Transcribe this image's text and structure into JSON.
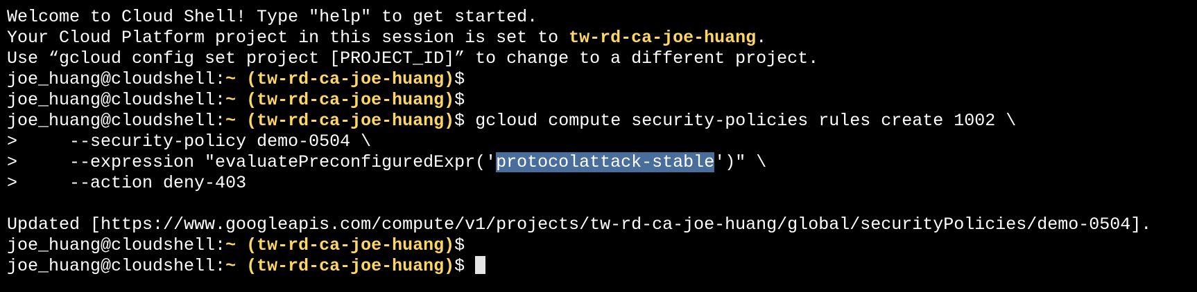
{
  "colors": {
    "background": "#000000",
    "text": "#ffffff",
    "project": "#fdd663",
    "selection": "#4a6e9c",
    "cursor": "#e5e5e5"
  },
  "welcome": {
    "line1": "Welcome to Cloud Shell! Type \"help\" to get started.",
    "line2_prefix": "Your Cloud Platform project in this session is set to ",
    "line2_project": "tw-rd-ca-joe-huang",
    "line2_suffix": ".",
    "line3": "Use “gcloud config set project [PROJECT_ID]” to change to a different project."
  },
  "prompt": {
    "user_host": "joe_huang@cloudshell:",
    "tilde": "~",
    "project": "(tw-rd-ca-joe-huang)",
    "dollar": "$"
  },
  "command": {
    "first": "gcloud compute security-policies rules create 1002 \\",
    "cont_marker": ">",
    "cont1": "     --security-policy demo-0504 \\",
    "cont2_before": "     --expression \"evaluatePreconfiguredExpr('",
    "cont2_selected": "protocolattack-stable",
    "cont2_after": "')\" \\",
    "cont3": "     --action deny-403"
  },
  "output": {
    "updated": "Updated [https://www.googleapis.com/compute/v1/projects/tw-rd-ca-joe-huang/global/securityPolicies/demo-0504]."
  }
}
